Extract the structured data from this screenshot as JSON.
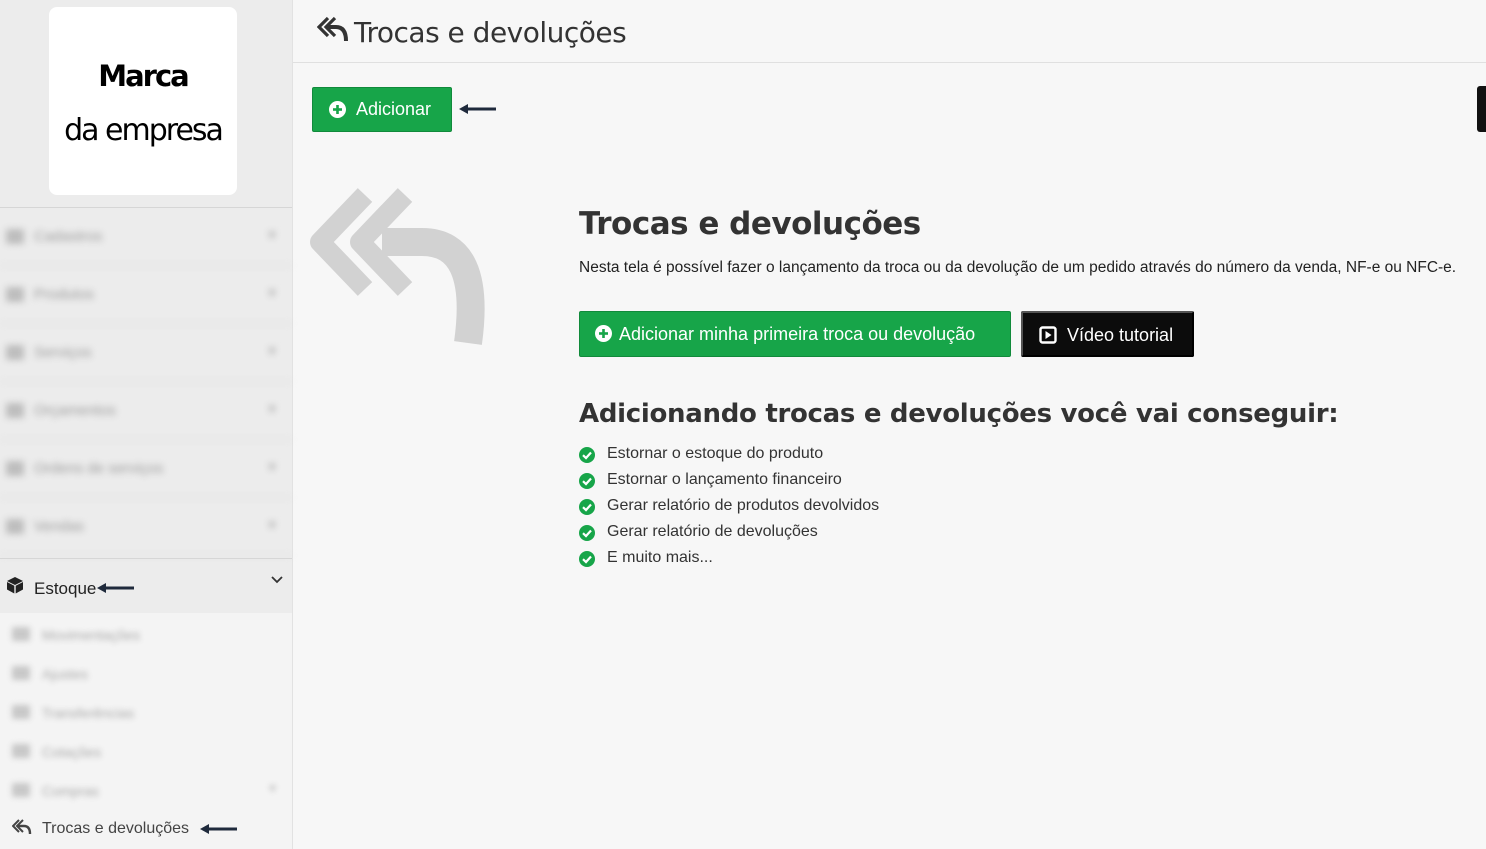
{
  "sidebar": {
    "logo": {
      "line1": "Marca",
      "line2": "da empresa"
    },
    "menu": [
      {
        "label": "Cadastros"
      },
      {
        "label": "Produtos"
      },
      {
        "label": "Serviços"
      },
      {
        "label": "Orçamentos"
      },
      {
        "label": "Ordens de serviços"
      },
      {
        "label": "Vendas"
      }
    ],
    "estoque": {
      "label": "Estoque",
      "submenu": [
        {
          "label": "Movimentações"
        },
        {
          "label": "Ajustes"
        },
        {
          "label": "Transferências"
        },
        {
          "label": "Cotações"
        },
        {
          "label": "Compras"
        }
      ],
      "active_item": "Trocas e devoluções"
    }
  },
  "header": {
    "title": "Trocas e devoluções",
    "icon": "reply-all-icon"
  },
  "toolbar": {
    "add_label": "Adicionar"
  },
  "main": {
    "heading": "Trocas e devoluções",
    "description": "Nesta tela é possível fazer o lançamento da troca ou da devolução de um pedido através do número da venda, NF-e ou NFC-e.",
    "primary_button": "Adicionar minha primeira troca ou devolução",
    "video_button": "Vídeo tutorial",
    "benefits_title": "Adicionando trocas e devoluções você vai conseguir:",
    "benefits": [
      "Estornar o estoque do produto",
      "Estornar o lançamento financeiro",
      "Gerar relatório de produtos devolvidos",
      "Gerar relatório de devoluções",
      "E muito mais..."
    ]
  },
  "colors": {
    "accent_green": "#17a549",
    "video_black": "#0c0c0c",
    "annotation_arrow": "#1f2a3c"
  }
}
